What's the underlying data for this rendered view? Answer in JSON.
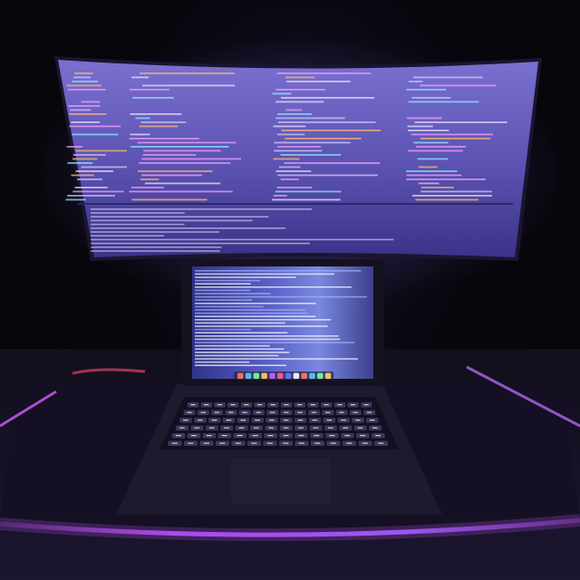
{
  "scene": {
    "description_colors": {
      "monitor_screen": "#6a5fc0",
      "ide_background": "#3c3580",
      "laptop_screen": "#3a3f8a",
      "desk_led_glow": "#b04cff",
      "desk_surface": "#0d0b14",
      "wall": "#060509"
    },
    "objects": [
      {
        "name": "ultrawide-monitor",
        "kind": "display",
        "content": "code-editor"
      },
      {
        "name": "laptop",
        "kind": "laptop",
        "content": "terminal-output"
      },
      {
        "name": "desk-mat",
        "kind": "desk",
        "lighting": "purple-led-strip"
      }
    ],
    "icons": [
      "dock-icons"
    ]
  }
}
